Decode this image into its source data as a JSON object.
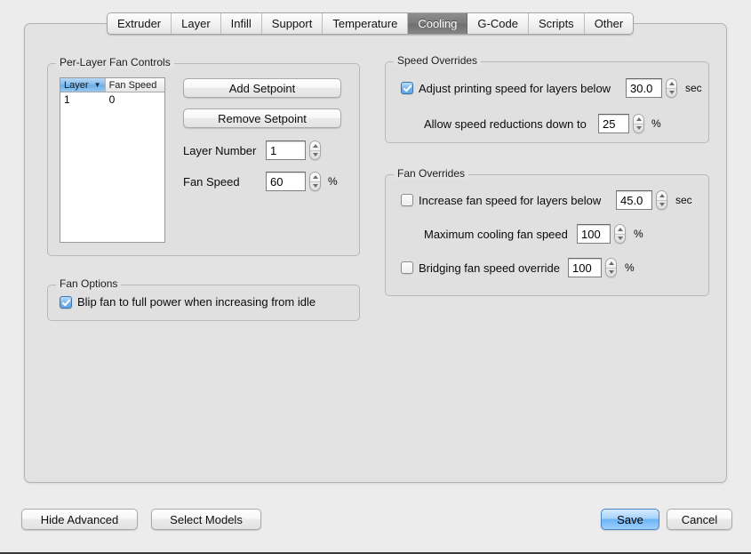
{
  "window": {
    "title": "Cooling",
    "background_color": "#ececec",
    "panel_color": "#e3e3e3",
    "accent_color": "#6cb3f6"
  },
  "tabs": [
    {
      "label": "Extruder",
      "selected": false
    },
    {
      "label": "Layer",
      "selected": false
    },
    {
      "label": "Infill",
      "selected": false
    },
    {
      "label": "Support",
      "selected": false
    },
    {
      "label": "Temperature",
      "selected": false
    },
    {
      "label": "Cooling",
      "selected": true
    },
    {
      "label": "G-Code",
      "selected": false
    },
    {
      "label": "Scripts",
      "selected": false
    },
    {
      "label": "Other",
      "selected": false
    }
  ],
  "per_layer_fan_controls": {
    "legend": "Per-Layer Fan Controls",
    "table": {
      "columns": [
        {
          "label": "Layer",
          "sorted": true,
          "sort_direction": "descending",
          "sort_glyph": "▼"
        },
        {
          "label": "Fan Speed",
          "sorted": false
        }
      ],
      "rows": [
        {
          "layer": "1",
          "fan_speed": "0"
        }
      ]
    },
    "add_setpoint_label": "Add Setpoint",
    "remove_setpoint_label": "Remove Setpoint",
    "layer_number": {
      "label": "Layer Number",
      "value": "1"
    },
    "fan_speed": {
      "label": "Fan Speed",
      "value": "60",
      "unit": "%"
    }
  },
  "fan_options": {
    "legend": "Fan Options",
    "blip_fan": {
      "label": "Blip fan to full power when increasing from idle",
      "checked": true
    }
  },
  "speed_overrides": {
    "legend": "Speed Overrides",
    "adjust_printing_speed": {
      "label": "Adjust printing speed for layers below",
      "checked": true,
      "value": "30.0",
      "unit": "sec"
    },
    "allow_speed_reductions": {
      "label": "Allow speed reductions down to",
      "value": "25",
      "unit": "%"
    }
  },
  "fan_overrides": {
    "legend": "Fan Overrides",
    "increase_fan_speed": {
      "label": "Increase fan speed for layers below",
      "checked": false,
      "value": "45.0",
      "unit": "sec"
    },
    "maximum_cooling_fan_speed": {
      "label": "Maximum cooling fan speed",
      "value": "100",
      "unit": "%"
    },
    "bridging_fan_speed_override": {
      "label": "Bridging fan speed override",
      "checked": false,
      "value": "100",
      "unit": "%"
    }
  },
  "footer": {
    "hide_advanced_label": "Hide Advanced",
    "select_models_label": "Select Models",
    "save_label": "Save",
    "cancel_label": "Cancel"
  }
}
